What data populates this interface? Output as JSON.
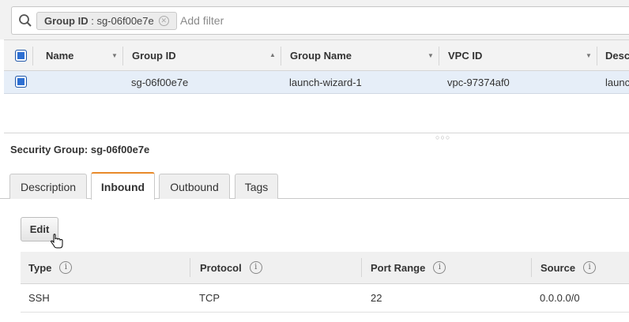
{
  "filter": {
    "chip_key": "Group ID",
    "chip_sep": " : ",
    "chip_value": "sg-06f00e7e",
    "add_filter_placeholder": "Add filter"
  },
  "grid": {
    "columns": [
      "Name",
      "Group ID",
      "Group Name",
      "VPC ID",
      "Desc"
    ],
    "rows": [
      {
        "name": "",
        "group_id": "sg-06f00e7e",
        "group_name": "launch-wizard-1",
        "vpc_id": "vpc-97374af0",
        "description": "launc"
      }
    ]
  },
  "details": {
    "title": "Security Group: sg-06f00e7e",
    "tabs": [
      "Description",
      "Inbound",
      "Outbound",
      "Tags"
    ],
    "active_tab": "Inbound",
    "edit_label": "Edit",
    "rules_columns": [
      "Type",
      "Protocol",
      "Port Range",
      "Source"
    ],
    "info_glyph": "i",
    "rules": [
      {
        "type": "SSH",
        "protocol": "TCP",
        "port_range": "22",
        "source": "0.0.0.0/0"
      }
    ]
  },
  "colors": {
    "accent_tab": "#e88a2a",
    "checkbox": "#2d6fd2",
    "selected_row": "#e6eef8"
  }
}
